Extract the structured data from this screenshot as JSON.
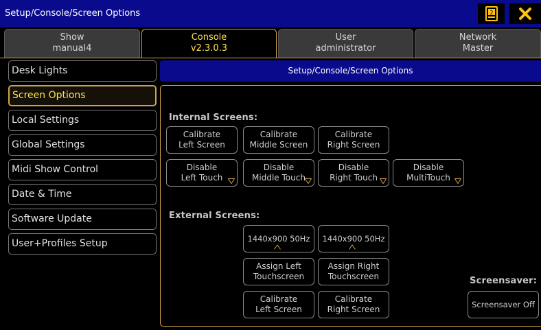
{
  "window": {
    "title": "Setup/Console/Screen Options"
  },
  "titlebar_buttons": {
    "number_icon": "numbered-window-icon",
    "close_icon": "close-x-icon"
  },
  "tabs": [
    {
      "line1": "Show",
      "line2": "manual4"
    },
    {
      "line1": "Console",
      "line2": "v2.3.0.3"
    },
    {
      "line1": "User",
      "line2": "administrator"
    },
    {
      "line1": "Network",
      "line2": "Master"
    }
  ],
  "menu": [
    {
      "label": "Desk Lights"
    },
    {
      "label": "Screen Options"
    },
    {
      "label": "Local Settings"
    },
    {
      "label": "Global Settings"
    },
    {
      "label": "Midi Show Control"
    },
    {
      "label": "Date & Time"
    },
    {
      "label": "Software Update"
    },
    {
      "label": "User+Profiles Setup"
    }
  ],
  "panel": {
    "header": "Setup/Console/Screen Options",
    "internal": {
      "label": "Internal Screens:",
      "calibrate": [
        {
          "l1": "Calibrate",
          "l2": "Left Screen"
        },
        {
          "l1": "Calibrate",
          "l2": "Middle Screen"
        },
        {
          "l1": "Calibrate",
          "l2": "Right Screen"
        }
      ],
      "disable": [
        {
          "l1": "Disable",
          "l2": "Left Touch"
        },
        {
          "l1": "Disable",
          "l2": "Middle Touch"
        },
        {
          "l1": "Disable",
          "l2": "Right Touch"
        },
        {
          "l1": "Disable",
          "l2": "MultiTouch"
        }
      ]
    },
    "external": {
      "label": "External Screens:",
      "resolutions": [
        "1440x900 50Hz",
        "1440x900 50Hz"
      ],
      "assign": [
        {
          "l1": "Assign Left",
          "l2": "Touchscreen"
        },
        {
          "l1": "Assign Right",
          "l2": "Touchscreen"
        }
      ],
      "calibrate": [
        {
          "l1": "Calibrate",
          "l2": "Left Screen"
        },
        {
          "l1": "Calibrate",
          "l2": "Right Screen"
        }
      ]
    },
    "screensaver": {
      "label": "Screensaver:",
      "button": "Screensaver Off"
    }
  },
  "colors": {
    "title_blue": "#0a0a8c",
    "accent_gold": "#d4a24c",
    "active_text": "#ffe34d",
    "close_yellow": "#ffc20e"
  }
}
